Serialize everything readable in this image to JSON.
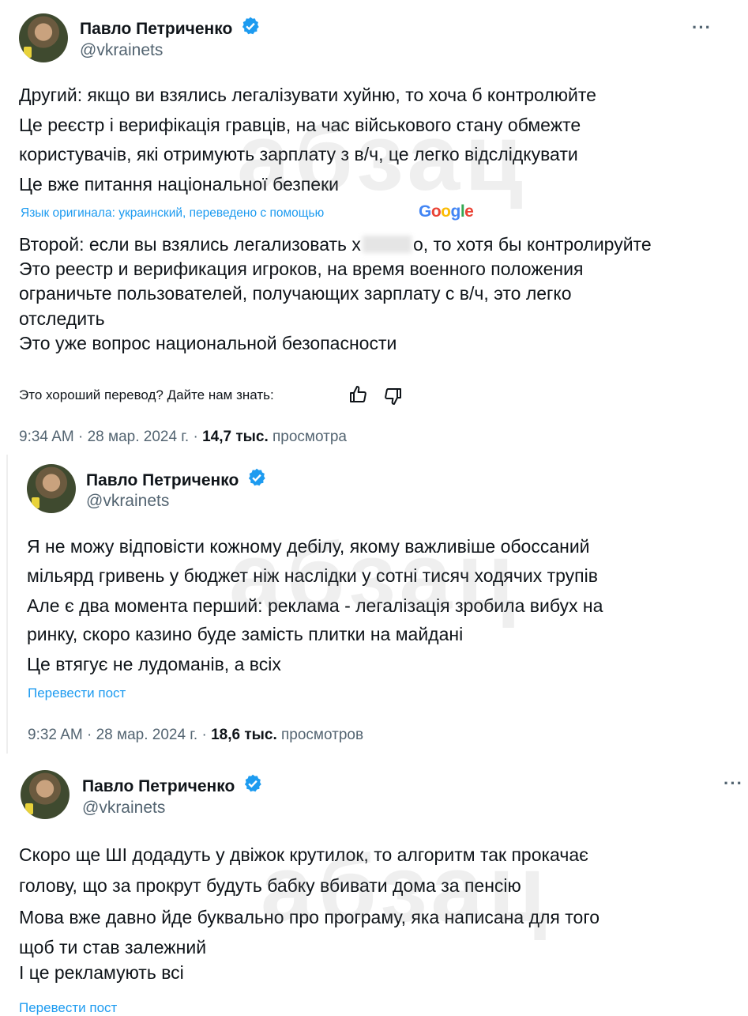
{
  "tweet1": {
    "author_name": "Павло Петриченко",
    "handle": "@vkrainets",
    "more_label": "···",
    "original_lines": [
      "Другий: якщо ви взялись легалізувати хуйню, то хоча б контролюйте",
      "Це реєстр і верифікація гравців, на час військового стану обмежте",
      "користувачів, які отримують зарплату з в/ч, це легко відслідкувати",
      "Це вже питання національної безпеки"
    ],
    "translation_note": "Язык оригинала: украинский, переведено с помощью",
    "translation_logo": "Google",
    "translated_line1_before": "Второй: если вы взялись легализовать х",
    "translated_line1_after": "о, то хотя бы контролируйте",
    "translated_lines": [
      "Это реестр и верификация игроков, на время военного положения",
      "ограничьте пользователей, получающих зарплату с в/ч, это легко",
      "отследить",
      "Это уже вопрос национальной безопасности"
    ],
    "feedback_prompt": "Это хороший перевод? Дайте нам знать:",
    "time": "9:34 AM · 28 мар. 2024 г. · ",
    "views_count": "14,7 тыс.",
    "views_label": " просмотра"
  },
  "tweet2": {
    "author_name": "Павло Петриченко",
    "handle": "@vkrainets",
    "lines": [
      "Я не можу відповісти кожному дебілу, якому важливіше обоссаний",
      "мільярд гривень у бюджет ніж наслідки у сотні тисяч ходячих трупів",
      "Але є два момента перший: реклама - легалізація зробила вибух на",
      "ринку, скоро казино буде замість плитки на майдані",
      "Це втягує не лудоманів, а всіх"
    ],
    "translate_link": "Перевести пост",
    "time": "9:32 AM · 28 мар. 2024 г. · ",
    "views_count": "18,6 тыс.",
    "views_label": " просмотров"
  },
  "tweet3": {
    "author_name": "Павло Петриченко",
    "handle": "@vkrainets",
    "more_label": "···",
    "lines": [
      "Скоро ще ШІ додадуть у двіжок крутилок, то алгоритм так прокачає",
      "голову, що за прокрут будуть бабку вбивати дома за пенсію",
      "Мова вже давно йде буквально про програму, яка написана для того",
      "щоб ти став залежний",
      "І це рекламують всі"
    ],
    "translate_link": "Перевести пост"
  },
  "watermark_text": "абзац",
  "colors": {
    "verified": "#1d9bf0",
    "link": "#1d9bf0",
    "secondary_text": "#536471",
    "google_blue": "#4285f4",
    "google_red": "#ea4335",
    "google_yellow": "#fbbc05",
    "google_green": "#34a853"
  }
}
